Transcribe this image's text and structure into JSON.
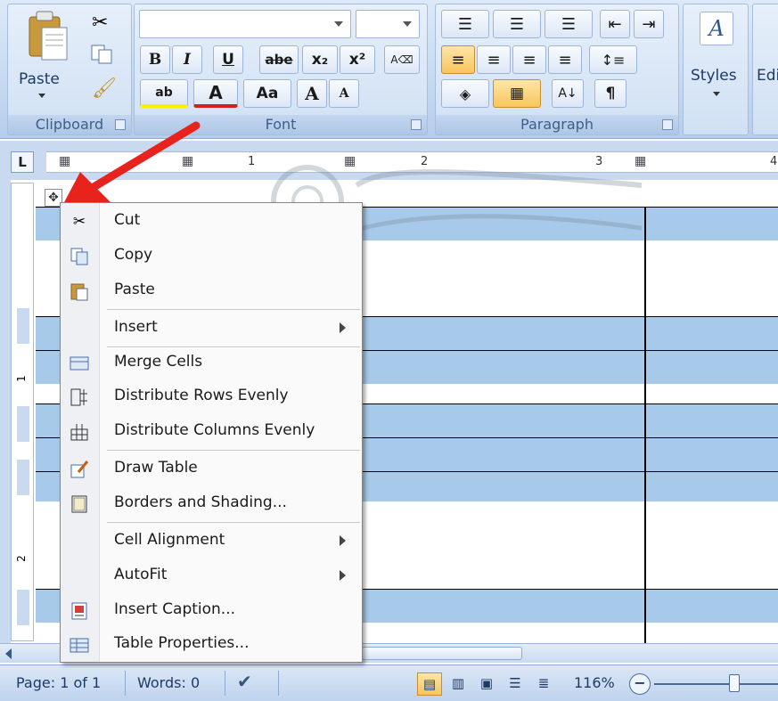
{
  "ribbon": {
    "clipboard": {
      "label": "Clipboard",
      "paste_label": "Paste"
    },
    "font": {
      "label": "Font",
      "bold": "B",
      "italic": "I",
      "underline": "U",
      "strikethrough": "abe",
      "subscript": "x₂",
      "superscript": "x²",
      "change_case": "Aa",
      "grow_font": "A",
      "shrink_font": "A",
      "font_color": "A",
      "highlight": "ab"
    },
    "paragraph": {
      "label": "Paragraph",
      "pilcrow": "¶"
    },
    "styles": {
      "label": "Styles"
    },
    "editing": {
      "label": "Edi"
    }
  },
  "ruler": {
    "corner": "L",
    "numbers": [
      "1",
      "2",
      "3",
      "4"
    ],
    "vertical_numbers": [
      "1",
      "2"
    ]
  },
  "context_menu": {
    "items": [
      {
        "label": "Cut",
        "icon": "scissors-icon",
        "submenu": false
      },
      {
        "label": "Copy",
        "icon": "copy-icon",
        "submenu": false
      },
      {
        "label": "Paste",
        "icon": "clipboard-icon",
        "submenu": false
      },
      {
        "label": "Insert",
        "icon": "",
        "submenu": true
      },
      {
        "label": "Merge Cells",
        "icon": "merge-cells-icon",
        "submenu": false
      },
      {
        "label": "Distribute Rows Evenly",
        "icon": "distribute-rows-icon",
        "submenu": false
      },
      {
        "label": "Distribute Columns Evenly",
        "icon": "distribute-columns-icon",
        "submenu": false
      },
      {
        "label": "Draw Table",
        "icon": "draw-table-icon",
        "submenu": false
      },
      {
        "label": "Borders and Shading...",
        "icon": "borders-icon",
        "submenu": false
      },
      {
        "label": "Cell Alignment",
        "icon": "",
        "submenu": true
      },
      {
        "label": "AutoFit",
        "icon": "",
        "submenu": true
      },
      {
        "label": "Insert Caption...",
        "icon": "caption-icon",
        "submenu": false
      },
      {
        "label": "Table Properties...",
        "icon": "table-properties-icon",
        "submenu": false
      }
    ]
  },
  "status_bar": {
    "page": "Page: 1 of 1",
    "words": "Words: 0",
    "zoom": "116%"
  },
  "colors": {
    "selection": "#a7c9ea",
    "arrow": "#e8231e",
    "ribbon": "#c5d9f1"
  }
}
